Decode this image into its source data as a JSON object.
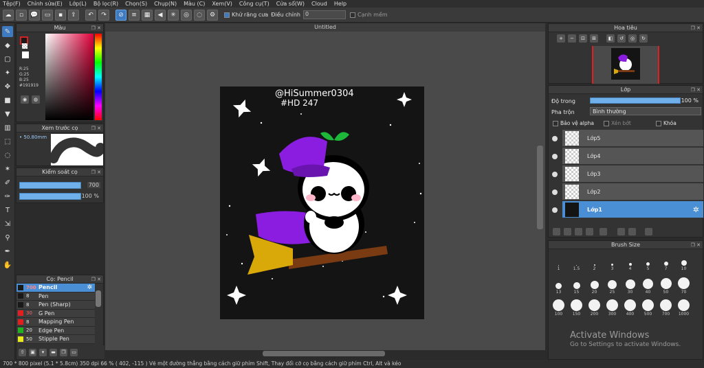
{
  "menu": [
    "Tệp(F)",
    "Chỉnh sửa(E)",
    "Lớp(L)",
    "Bộ lọc(R)",
    "Chọn(S)",
    "Chụp(N)",
    "Màu (C)",
    "Xem(V)",
    "Công cụ(T)",
    "Cửa sổ(W)",
    "Cloud",
    "Help"
  ],
  "toolbar": {
    "antialias_label": "Khử răng cưa",
    "adjust_label": "Điều chỉnh",
    "adjust_value": "0",
    "edge_label": "Cạnh mềm"
  },
  "color_panel": {
    "title": "Màu",
    "r": "R:25",
    "g": "G:25",
    "b": "B:25",
    "hex": "#191919",
    "fg_color": "#191919",
    "border_color": "#d52121"
  },
  "preview_panel": {
    "title": "Xem trước cọ",
    "size": "50.80mm"
  },
  "control_panel": {
    "title": "Kiểm soát cọ",
    "size_value": "700",
    "opacity_value": "100 %"
  },
  "brush_panel": {
    "title": "Cọ: Pencil",
    "items": [
      {
        "num": "700",
        "name": "Pencil",
        "color": "#191919",
        "active": true
      },
      {
        "num": "8",
        "name": "Pen",
        "color": "#191919"
      },
      {
        "num": "8",
        "name": "Pen (Sharp)",
        "color": "#191919"
      },
      {
        "num": "30",
        "name": "G Pen",
        "color": "#e02020"
      },
      {
        "num": "8",
        "name": "Mapping Pen",
        "color": "#e02020"
      },
      {
        "num": "20",
        "name": "Edge Pen",
        "color": "#20b020"
      },
      {
        "num": "50",
        "name": "Stipple Pen",
        "color": "#e8e820"
      }
    ]
  },
  "document": {
    "title": "Untitled",
    "watermark_line1": "@HiSummer0304",
    "watermark_line2": "#HD 247"
  },
  "navigator": {
    "title": "Hoa tiêu"
  },
  "layer_panel": {
    "title": "Lớp",
    "opacity_label": "Độ trong",
    "opacity_value": "100 %",
    "blend_label": "Pha trộn",
    "blend_value": "Bình thường",
    "protect_alpha": "Bảo vệ alpha",
    "clipping": "Xén bớt",
    "lock": "Khóa",
    "layers": [
      "Lớp5",
      "Lớp4",
      "Lớp3",
      "Lớp2",
      "Lớp1"
    ],
    "active_layer": "Lớp1"
  },
  "brush_size": {
    "title": "Brush Size",
    "row1": [
      "1",
      "1.5",
      "2",
      "3",
      "4",
      "5",
      "7",
      "10"
    ],
    "row2": [
      "13",
      "15",
      "20",
      "25",
      "30",
      "40",
      "50",
      "70"
    ],
    "row3": [
      "100",
      "150",
      "200",
      "300",
      "400",
      "500",
      "700",
      "1000"
    ]
  },
  "watermark": {
    "line1": "Activate Windows",
    "line2": "Go to Settings to activate Windows."
  },
  "status": {
    "text": "700 * 800 pixel   (5.1 * 5.8cm)   350 dpi   66 %   ( 402, -115 )   Vẽ một đường thẳng bằng cách giữ phím Shift, Thay đổi cỡ cọ bằng cách giữ phím Ctrl, Alt và kéo"
  }
}
